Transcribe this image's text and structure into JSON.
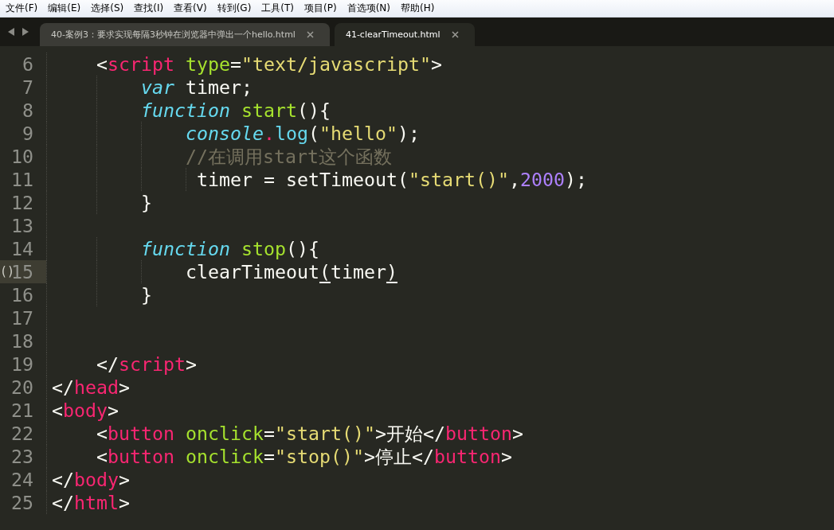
{
  "menu": [
    "文件(F)",
    "编辑(E)",
    "选择(S)",
    "查找(I)",
    "查看(V)",
    "转到(G)",
    "工具(T)",
    "项目(P)",
    "首选项(N)",
    "帮助(H)"
  ],
  "tabs": [
    {
      "label": "40-案例3：要求实现每隔3秒钟在浏览器中弹出一个hello.html",
      "selected": false
    },
    {
      "label": "41-clearTimeout.html",
      "selected": true
    }
  ],
  "lines": [
    {
      "number": "6",
      "current": false,
      "tokens": [
        {
          "kind": "plain",
          "text": "    <"
        },
        {
          "kind": "tag",
          "text": "script"
        },
        {
          "kind": "attr",
          "text": " type"
        },
        {
          "kind": "plain",
          "text": "="
        },
        {
          "kind": "string",
          "text": "\"text/javascript\""
        },
        {
          "kind": "plain",
          "text": ">"
        }
      ]
    },
    {
      "number": "7",
      "current": false,
      "tokens": [
        {
          "kind": "storage",
          "text": "        var"
        },
        {
          "kind": "plain",
          "text": " timer;"
        }
      ]
    },
    {
      "number": "8",
      "current": false,
      "tokens": [
        {
          "kind": "storage",
          "text": "        function"
        },
        {
          "kind": "entity",
          "text": " start"
        },
        {
          "kind": "plain",
          "text": "(){"
        }
      ]
    },
    {
      "number": "9",
      "current": false,
      "tokens": [
        {
          "kind": "storage",
          "text": "            console"
        },
        {
          "kind": "operator",
          "text": "."
        },
        {
          "kind": "func",
          "text": "log"
        },
        {
          "kind": "plain",
          "text": "("
        },
        {
          "kind": "string",
          "text": "\"hello\""
        },
        {
          "kind": "plain",
          "text": ");"
        }
      ]
    },
    {
      "number": "10",
      "current": false,
      "tokens": [
        {
          "kind": "comment",
          "text": "            //在调用start这个函数"
        }
      ]
    },
    {
      "number": "11",
      "current": false,
      "tokens": [
        {
          "kind": "plain",
          "text": "             timer = setTimeout("
        },
        {
          "kind": "string",
          "text": "\"start()\""
        },
        {
          "kind": "plain",
          "text": ","
        },
        {
          "kind": "number",
          "text": "2000"
        },
        {
          "kind": "plain",
          "text": ");"
        }
      ]
    },
    {
      "number": "12",
      "current": false,
      "tokens": [
        {
          "kind": "plain",
          "text": "        }"
        }
      ]
    },
    {
      "number": "13",
      "current": false
    },
    {
      "number": "14",
      "current": false,
      "tokens": [
        {
          "kind": "storage",
          "text": "        function"
        },
        {
          "kind": "entity",
          "text": " stop"
        },
        {
          "kind": "plain",
          "text": "(){"
        }
      ]
    },
    {
      "number": "15",
      "current": true,
      "gutter_mark": "()",
      "tokens": [
        {
          "kind": "plain",
          "text": "            clearTimeout"
        },
        {
          "kind": "bracket",
          "text": "("
        },
        {
          "kind": "plain",
          "text": "timer"
        },
        {
          "kind": "bracket",
          "text": ")"
        }
      ]
    },
    {
      "number": "16",
      "current": false,
      "tokens": [
        {
          "kind": "plain",
          "text": "        }"
        }
      ]
    },
    {
      "number": "17",
      "current": false
    },
    {
      "number": "18",
      "current": false
    },
    {
      "number": "19",
      "current": false,
      "tokens": [
        {
          "kind": "plain",
          "text": "    </"
        },
        {
          "kind": "tag",
          "text": "script"
        },
        {
          "kind": "plain",
          "text": ">"
        }
      ]
    },
    {
      "number": "20",
      "current": false,
      "tokens": [
        {
          "kind": "plain",
          "text": "</"
        },
        {
          "kind": "tag",
          "text": "head"
        },
        {
          "kind": "plain",
          "text": ">"
        }
      ]
    },
    {
      "number": "21",
      "current": false,
      "tokens": [
        {
          "kind": "plain",
          "text": "<"
        },
        {
          "kind": "tag",
          "text": "body"
        },
        {
          "kind": "plain",
          "text": ">"
        }
      ]
    },
    {
      "number": "22",
      "current": false,
      "tokens": [
        {
          "kind": "plain",
          "text": "    <"
        },
        {
          "kind": "tag",
          "text": "button"
        },
        {
          "kind": "attr",
          "text": " onclick"
        },
        {
          "kind": "plain",
          "text": "="
        },
        {
          "kind": "string",
          "text": "\"start()\""
        },
        {
          "kind": "plain",
          "text": ">开始</"
        },
        {
          "kind": "tag",
          "text": "button"
        },
        {
          "kind": "plain",
          "text": ">"
        }
      ]
    },
    {
      "number": "23",
      "current": false,
      "tokens": [
        {
          "kind": "plain",
          "text": "    <"
        },
        {
          "kind": "tag",
          "text": "button"
        },
        {
          "kind": "attr",
          "text": " onclick"
        },
        {
          "kind": "plain",
          "text": "="
        },
        {
          "kind": "string",
          "text": "\"stop()\""
        },
        {
          "kind": "plain",
          "text": ">停止</"
        },
        {
          "kind": "tag",
          "text": "button"
        },
        {
          "kind": "plain",
          "text": ">"
        }
      ]
    },
    {
      "number": "24",
      "current": false,
      "tokens": [
        {
          "kind": "plain",
          "text": "</"
        },
        {
          "kind": "tag",
          "text": "body"
        },
        {
          "kind": "plain",
          "text": ">"
        }
      ]
    },
    {
      "number": "25",
      "current": false,
      "tokens": [
        {
          "kind": "plain",
          "text": "</"
        },
        {
          "kind": "tag",
          "text": "html"
        },
        {
          "kind": "plain",
          "text": ">"
        }
      ]
    }
  ]
}
